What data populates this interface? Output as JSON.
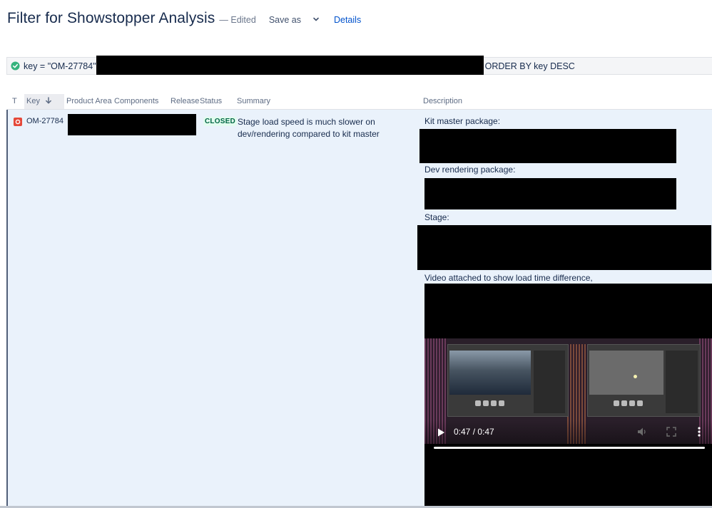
{
  "header": {
    "title": "Filter for Showstopper Analysis",
    "edited": "— Edited",
    "save_as": "Save as",
    "details": "Details"
  },
  "jql": {
    "prefix": "key = \"OM-27784\"",
    "suffix": "ORDER BY key DESC"
  },
  "table": {
    "columns": [
      "T",
      "Key",
      "Product Area",
      "Components",
      "Release",
      "Status",
      "Summary",
      "Description"
    ],
    "row": {
      "key": "OM-27784",
      "status": "CLOSED",
      "summary": "Stage load speed is much slower on dev/rendering compared to kit master",
      "description": {
        "kit_master_label": "Kit master package:",
        "dev_rendering_label": "Dev rendering package:",
        "stage_label": "Stage:",
        "video_label": "Video attached to show load time difference,"
      }
    }
  },
  "video": {
    "time": "0:47 / 0:47",
    "progress": 1.0
  },
  "colors": {
    "title": "#172b4d",
    "link": "#0052cc",
    "row_highlight": "#eaf2fb",
    "status_closed": "#006644",
    "status_closed_bg": "#e3fcef",
    "bug_icon": "#e5493a",
    "valid_check": "#36b37e"
  },
  "icons": {
    "valid": "check-circle-icon",
    "sort": "arrow-down-icon",
    "issue_type": "bug-icon",
    "play": "play-icon",
    "volume": "volume-icon",
    "fullscreen": "fullscreen-icon",
    "more": "more-vertical-icon"
  }
}
